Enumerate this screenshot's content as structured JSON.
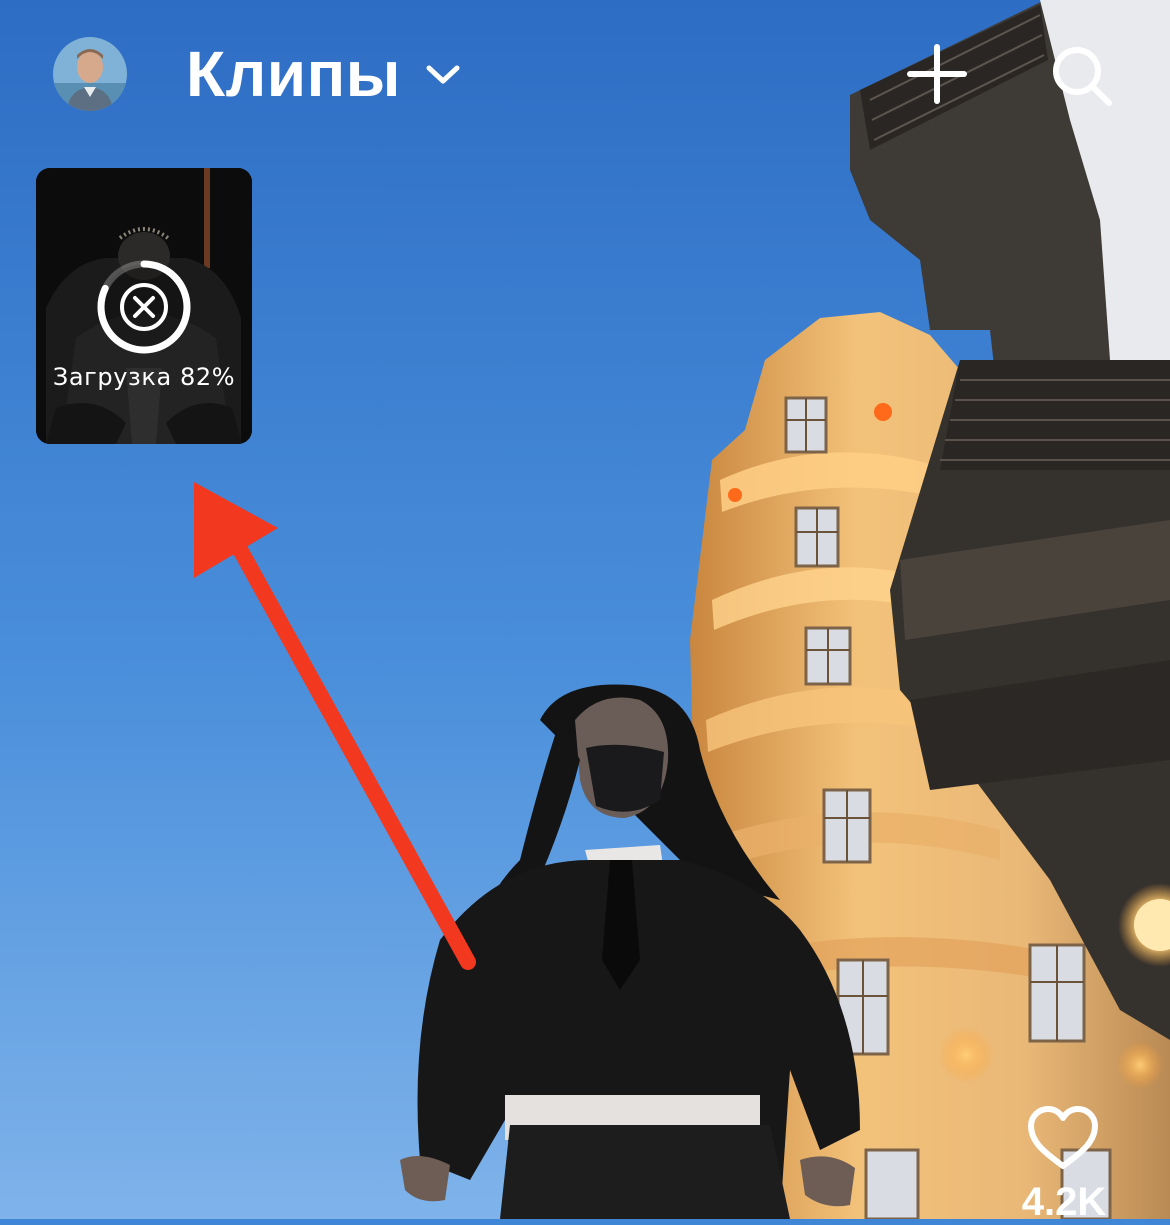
{
  "header": {
    "title": "Клипы",
    "title_menu_icon": "chevron-down-icon",
    "avatar_icon": "user-avatar",
    "add_icon": "plus-icon",
    "search_icon": "search-icon"
  },
  "upload": {
    "label": "Загрузка 82%",
    "progress": 0.82,
    "cancel_icon": "close-icon"
  },
  "actions": {
    "like_icon": "heart-icon",
    "like_count": "4.2K"
  },
  "colors": {
    "sky_top": "#2e72cb",
    "sky_bottom": "#6aa6e6",
    "annotation_arrow": "#f2391f",
    "building_light": "#f0a646",
    "ui_text": "#ffffff"
  }
}
